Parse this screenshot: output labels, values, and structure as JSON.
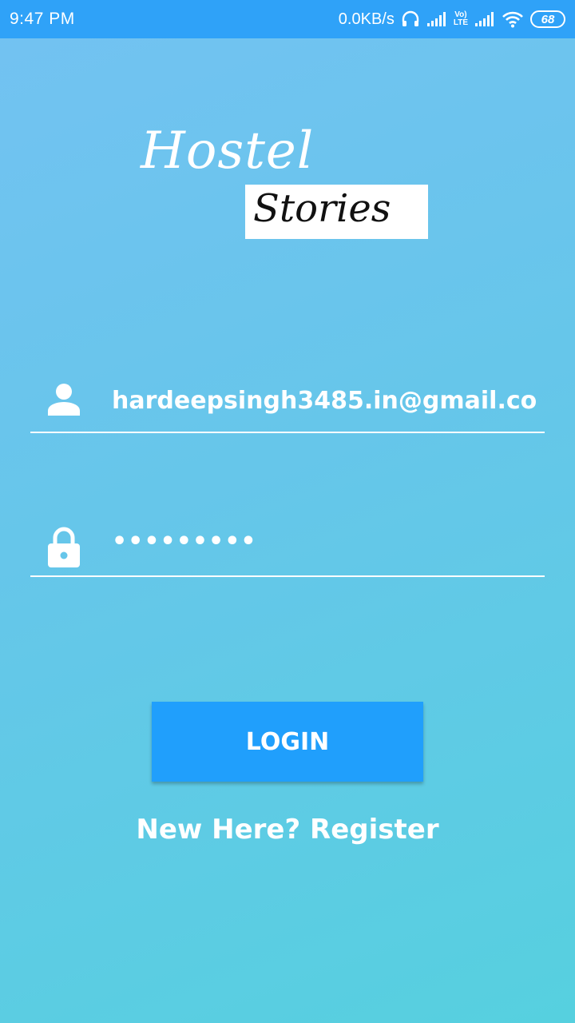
{
  "status_bar": {
    "time": "9:47 PM",
    "network_speed": "0.0KB/s",
    "volte_label_top": "Vo)",
    "volte_label_bottom": "LTE",
    "battery_level": "68",
    "icons": [
      "headset-icon",
      "signal-icon",
      "volte-icon",
      "signal-icon",
      "wifi-icon",
      "battery-icon"
    ]
  },
  "logo": {
    "line1": "Hostel",
    "line2": "Stories"
  },
  "login_form": {
    "email_icon": "user-icon",
    "email_value": "hardeepsingh3485.in@gmail.co",
    "password_icon": "lock-icon",
    "password_value": "•••••••••",
    "login_label": "LOGIN",
    "register_label": "New Here? Register"
  },
  "colors": {
    "status_bar_bg": "#2fa2f8",
    "gradient_top": "#73c2f2",
    "gradient_bottom": "#56d0df",
    "button_bg": "#209ffc",
    "text": "#ffffff"
  }
}
